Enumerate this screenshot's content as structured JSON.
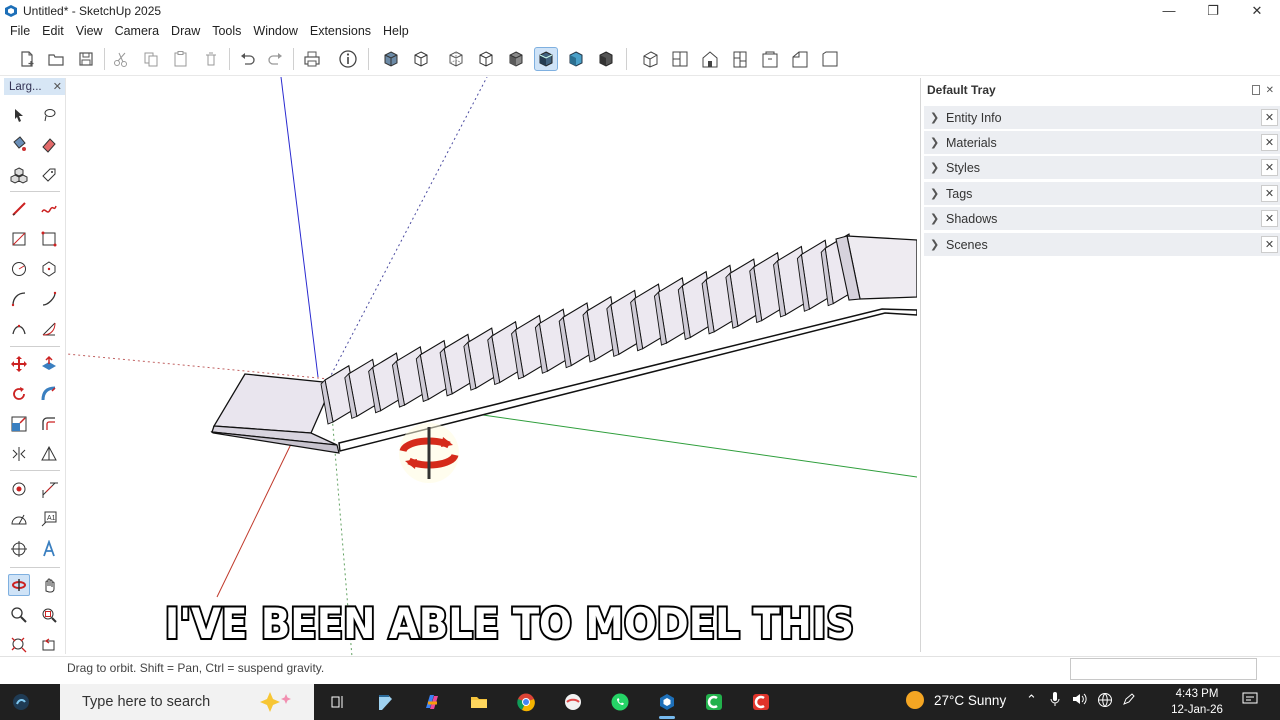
{
  "window": {
    "title": "Untitled* - SketchUp 2025",
    "minimize": "—",
    "restore": "❐",
    "close": "✕"
  },
  "menu": [
    "File",
    "Edit",
    "View",
    "Camera",
    "Draw",
    "Tools",
    "Window",
    "Extensions",
    "Help"
  ],
  "toolbar": {
    "groups": [
      [
        "new-icon",
        "open-icon",
        "save-icon"
      ],
      [
        "cut-icon",
        "copy-icon",
        "paste-icon",
        "erase-icon"
      ],
      [
        "undo-icon",
        "redo-icon"
      ],
      [
        "print-icon",
        "model-info-icon"
      ],
      [
        "xray-icon",
        "back-edges-icon",
        "wireframe-icon",
        "hidden-line-icon",
        "shaded-icon",
        "shaded-textures-icon",
        "monochrome-icon"
      ],
      [
        "iso-view-icon",
        "top-view-icon",
        "front-view-icon",
        "right-view-icon",
        "back-view-icon",
        "left-view-icon",
        "bottom-view-icon"
      ]
    ],
    "active_tool": "shaded-with-textures-icon"
  },
  "left_toolbar": {
    "title": "Larg...",
    "close": "✕",
    "active_tool": "orbit-icon"
  },
  "tray": {
    "title": "Default Tray",
    "pin": "📌",
    "close": "✕",
    "panels": [
      {
        "label": "Entity Info"
      },
      {
        "label": "Materials"
      },
      {
        "label": "Styles"
      },
      {
        "label": "Tags"
      },
      {
        "label": "Shadows"
      },
      {
        "label": "Scenes"
      }
    ]
  },
  "caption": "I'VE BEEN ABLE TO MODEL THIS",
  "status": {
    "hint": "Drag to orbit. Shift = Pan, Ctrl = suspend gravity.",
    "measurements": ""
  },
  "taskbar": {
    "search_placeholder": "Type here to search",
    "weather": "27°C  Sunny",
    "time": "4:43 PM",
    "date": "12-Jan-26"
  },
  "colors": {
    "accent": "#1a73c8",
    "axis_red": "#c0392b",
    "axis_green": "#2e9e3b",
    "axis_blue": "#2a2ad0",
    "taskbar": "#202020",
    "panel": "#eceef2"
  }
}
